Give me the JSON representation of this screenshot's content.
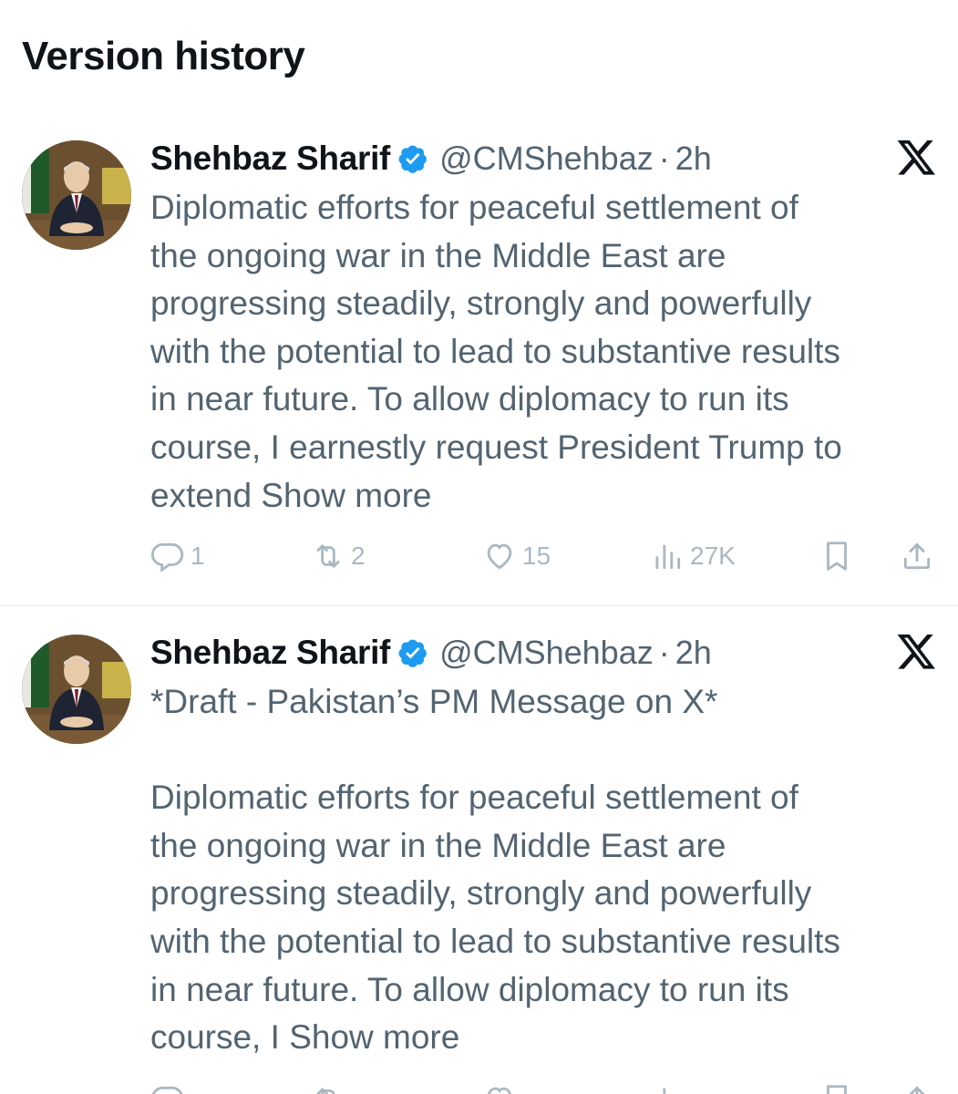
{
  "page": {
    "title": "Version history"
  },
  "tweets": [
    {
      "display_name": "Shehbaz Sharif",
      "handle": "@CMShehbaz",
      "separator": "·",
      "time": "2h",
      "body": "Diplomatic efforts for peaceful settlement of\nthe ongoing war in the Middle East are\nprogressing steadily, strongly and powerfully\nwith the potential to lead to substantive results\nin near future. To allow diplomacy to run its\ncourse, I earnestly request President Trump to\nextend ",
      "show_more": "Show more",
      "actions": {
        "replies": "1",
        "reposts": "2",
        "likes": "15",
        "views": "27K"
      }
    },
    {
      "display_name": "Shehbaz Sharif",
      "handle": "@CMShehbaz",
      "separator": "·",
      "time": "2h",
      "body": "*Draft - Pakistan’s PM Message on X*\n\nDiplomatic efforts for peaceful settlement of\nthe ongoing war in the Middle East are\nprogressing steadily, strongly and powerfully\nwith the potential to lead to substantive results\nin near future. To allow diplomacy to run its\ncourse, I ",
      "show_more": "Show more"
    }
  ],
  "colors": {
    "text": "#0f1419",
    "secondary": "#536471",
    "verified": "#1d9bf0",
    "action": "#aab8c2"
  },
  "icons": [
    "verified-badge-icon",
    "x-logo-icon",
    "reply-icon",
    "repost-icon",
    "like-icon",
    "views-icon",
    "bookmark-icon",
    "share-icon"
  ]
}
